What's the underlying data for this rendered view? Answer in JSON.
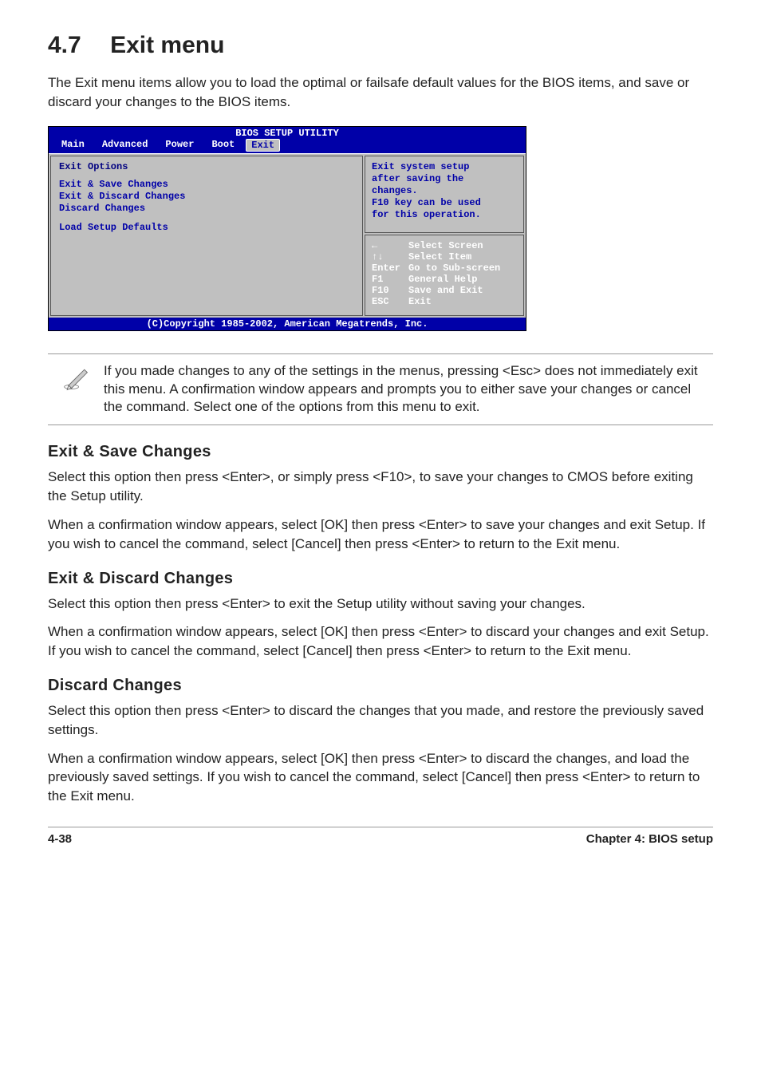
{
  "page": {
    "section_number": "4.7",
    "title": "Exit menu",
    "intro": "The Exit menu items allow you to load the optimal or failsafe default values for the BIOS items, and save or discard your changes to the BIOS items."
  },
  "bios": {
    "title": "BIOS SETUP UTILITY",
    "tabs": [
      "Main",
      "Advanced",
      "Power",
      "Boot",
      "Exit"
    ],
    "selected_tab": "Exit",
    "left": {
      "header": "Exit Options",
      "items": [
        "Exit & Save Changes",
        "Exit & Discard Changes",
        "Discard Changes",
        "",
        "Load Setup Defaults"
      ]
    },
    "right_top": [
      "Exit system setup",
      "after saving the",
      "changes.",
      "",
      "F10 key can be used",
      "for this operation."
    ],
    "right_bottom": [
      {
        "key": "←",
        "label": "Select Screen"
      },
      {
        "key": "↑↓",
        "label": "Select Item"
      },
      {
        "key": "Enter",
        "label": "Go to Sub-screen"
      },
      {
        "key": "F1",
        "label": "General Help"
      },
      {
        "key": "F10",
        "label": "Save and Exit"
      },
      {
        "key": "ESC",
        "label": "Exit"
      }
    ],
    "footer": "(C)Copyright 1985-2002, American Megatrends, Inc."
  },
  "note": {
    "text": "If you made changes to any of the settings in the menus, pressing <Esc> does not immediately exit this menu. A confirmation window appears and prompts you to either save your changes or cancel the command. Select one of the options from this menu to exit."
  },
  "sections": [
    {
      "heading": "Exit & Save Changes",
      "paragraphs": [
        "Select this option then press <Enter>, or simply press <F10>, to save your changes to CMOS before exiting the Setup utility.",
        "When a confirmation window appears, select [OK] then press <Enter> to save your changes and exit Setup. If you wish to cancel the command, select [Cancel] then press <Enter> to return to the Exit menu."
      ]
    },
    {
      "heading": "Exit & Discard Changes",
      "paragraphs": [
        "Select this option then press <Enter> to exit the Setup utility without saving your changes.",
        "When a confirmation window appears, select [OK] then press <Enter> to discard your changes and exit Setup. If you wish to cancel the command, select [Cancel] then press <Enter> to return to the Exit menu."
      ]
    },
    {
      "heading": "Discard Changes",
      "paragraphs": [
        "Select this option then press <Enter> to discard the changes that you made, and restore the previously saved settings.",
        "When a confirmation window appears, select [OK] then press <Enter> to discard the changes, and load the previously saved settings. If you wish to cancel the command, select [Cancel] then press <Enter> to return to the Exit menu."
      ]
    }
  ],
  "footer": {
    "left": "4-38",
    "right": "Chapter 4: BIOS setup"
  }
}
